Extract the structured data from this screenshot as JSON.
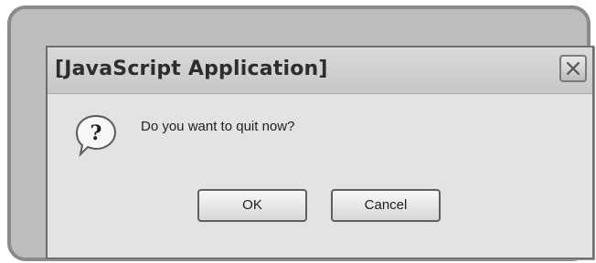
{
  "dialog": {
    "title": "[JavaScript Application]",
    "message": "Do you want to quit now?",
    "icon": "question-icon",
    "close_icon": "close-icon",
    "buttons": {
      "ok_label": "OK",
      "cancel_label": "Cancel"
    }
  }
}
